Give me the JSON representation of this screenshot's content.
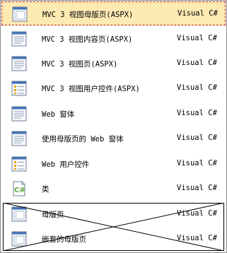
{
  "items": [
    {
      "name": "MVC 3 视图母版页(ASPX)",
      "language": "Visual C#",
      "icon": "master-page-icon",
      "selected": true
    },
    {
      "name": "MVC 3 视图内容页(ASPX)",
      "language": "Visual C#",
      "icon": "content-page-icon",
      "selected": false
    },
    {
      "name": "MVC 3 视图页(ASPX)",
      "language": "Visual C#",
      "icon": "view-page-icon",
      "selected": false
    },
    {
      "name": "MVC 3 视图用户控件(ASPX)",
      "language": "Visual C#",
      "icon": "user-control-icon",
      "selected": false
    },
    {
      "name": "Web 窗体",
      "language": "Visual C#",
      "icon": "web-form-icon",
      "selected": false
    },
    {
      "name": "使用母版页的 Web 窗体",
      "language": "Visual C#",
      "icon": "web-form-master-icon",
      "selected": false
    },
    {
      "name": "Web 用户控件",
      "language": "Visual C#",
      "icon": "web-user-control-icon",
      "selected": false
    },
    {
      "name": "类",
      "language": "Visual C#",
      "icon": "csharp-class-icon",
      "selected": false
    },
    {
      "name": "母版页",
      "language": "Visual C#",
      "icon": "master-page-icon",
      "selected": false
    },
    {
      "name": "嵌套的母版页",
      "language": "Visual C#",
      "icon": "nested-master-page-icon",
      "selected": false
    }
  ],
  "colors": {
    "selection_bg": "#fde9b2",
    "selection_border": "#b42020",
    "icon_blue": "#3f72b8",
    "icon_green": "#5aa63c"
  }
}
